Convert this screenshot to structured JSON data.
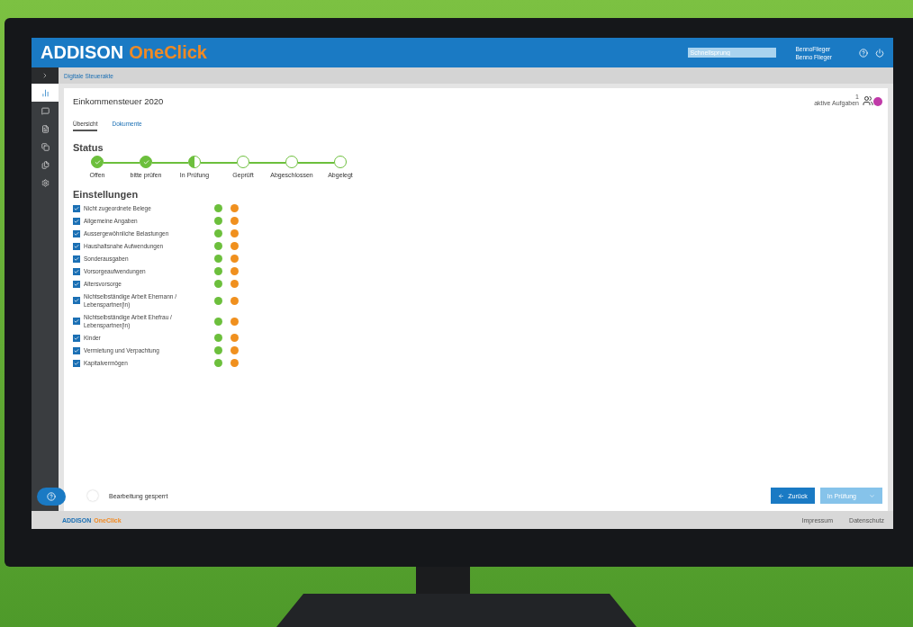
{
  "header": {
    "logo_main": "ADDISON",
    "logo_product": "OneClick",
    "search": {
      "placeholder": "Schnellsprung"
    },
    "user_login": "BennoFlieger",
    "user_name": "Benno Flieger"
  },
  "breadcrumb": "Digitale Steuerakte",
  "sidebar": {
    "items": [
      {
        "selected": true
      },
      {
        "selected": false
      },
      {
        "selected": false
      },
      {
        "selected": false
      },
      {
        "selected": false
      },
      {
        "selected": false
      }
    ]
  },
  "page": {
    "title": "Einkommensteuer 2020",
    "task_count": "1",
    "task_label": "aktive Aufgaben",
    "tabs": [
      {
        "label": "Übersicht",
        "selected": true
      },
      {
        "label": "Dokumente",
        "selected": false
      }
    ],
    "status": {
      "heading": "Status",
      "steps": [
        {
          "label": "Offen",
          "kind": "done"
        },
        {
          "label": "bitte prüfen",
          "kind": "done"
        },
        {
          "label": "In Prüfung",
          "kind": "partial"
        },
        {
          "label": "Geprüft",
          "kind": "open"
        },
        {
          "label": "Abgeschlossen",
          "kind": "open"
        },
        {
          "label": "Abgelegt",
          "kind": "open"
        }
      ]
    },
    "settings": {
      "heading": "Einstellungen",
      "items": [
        {
          "label": "Nicht zugeordnete Belege",
          "checked": true
        },
        {
          "label": "Allgemeine Angaben",
          "checked": true
        },
        {
          "label": "Aussergewöhnliche Belastungen",
          "checked": true
        },
        {
          "label": "Haushaltsnahe Aufwendungen",
          "checked": true
        },
        {
          "label": "Sonderausgaben",
          "checked": true
        },
        {
          "label": "Vorsorgeaufwendungen",
          "checked": true
        },
        {
          "label": "Altersvorsorge",
          "checked": true
        },
        {
          "label": "Nichtselbständige Arbeit Ehemann / Lebenspartner(in)",
          "checked": true
        },
        {
          "label": "Nichtselbständige Arbeit Ehefrau / Lebenspartner(in)",
          "checked": true
        },
        {
          "label": "Kinder",
          "checked": true
        },
        {
          "label": "Vermietung und Verpachtung",
          "checked": true
        },
        {
          "label": "Kapitalvermögen",
          "checked": true
        }
      ]
    },
    "lock": {
      "label": "Bearbeitung gesperrt",
      "on": false
    },
    "buttons": [
      {
        "label": "Zurück",
        "kind": "back",
        "disabled": false
      },
      {
        "label": "In Prüfung",
        "kind": "next",
        "disabled": true
      }
    ]
  },
  "footer": {
    "logo_main": "ADDISON",
    "logo_product": "OneClick",
    "links": [
      "Impressum",
      "Datenschutz"
    ]
  }
}
